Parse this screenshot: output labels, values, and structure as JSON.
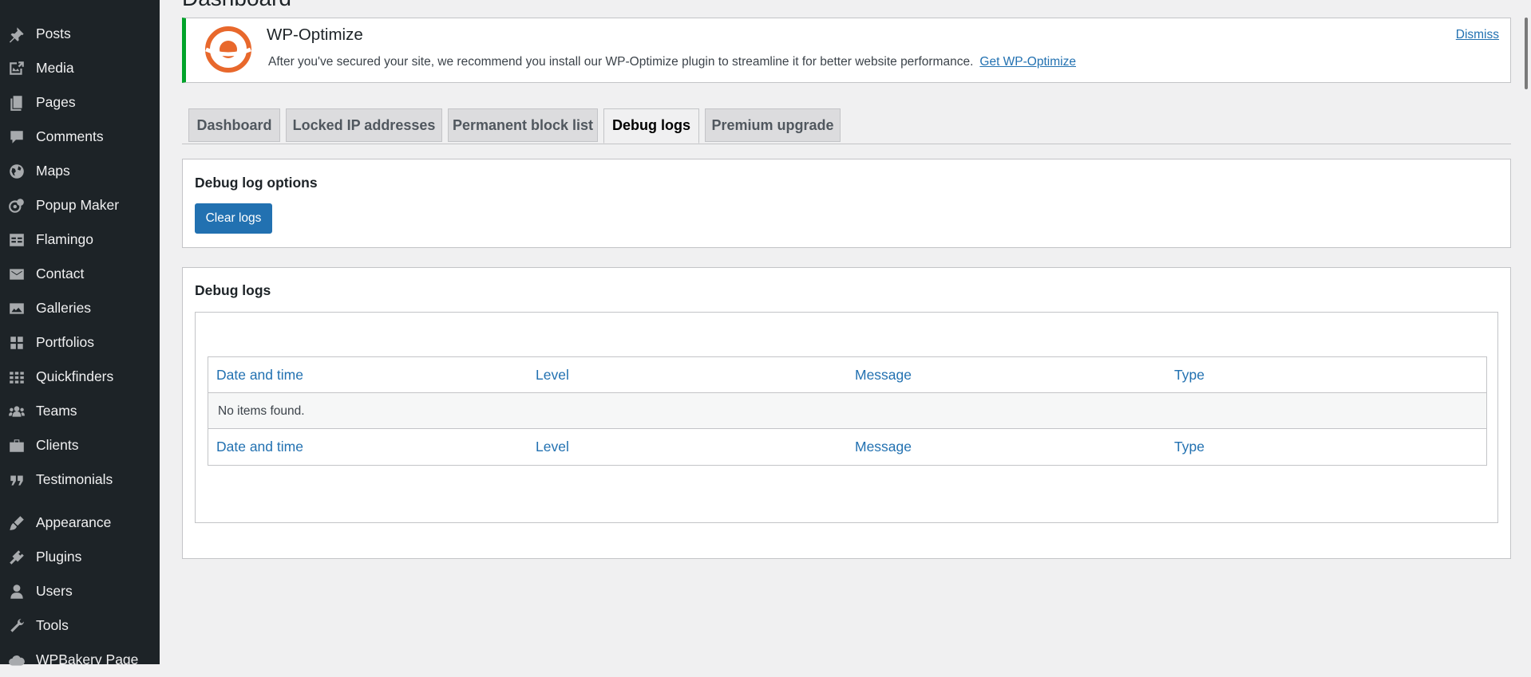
{
  "sidebar": {
    "items": [
      {
        "label": "Posts",
        "icon": "pin-icon"
      },
      {
        "label": "Media",
        "icon": "media-icon"
      },
      {
        "label": "Pages",
        "icon": "pages-icon"
      },
      {
        "label": "Comments",
        "icon": "comment-icon"
      },
      {
        "label": "Maps",
        "icon": "globe-icon"
      },
      {
        "label": "Popup Maker",
        "icon": "popup-icon"
      },
      {
        "label": "Flamingo",
        "icon": "feedback-icon"
      },
      {
        "label": "Contact",
        "icon": "email-icon"
      },
      {
        "label": "Galleries",
        "icon": "image-icon"
      },
      {
        "label": "Portfolios",
        "icon": "grid-icon"
      },
      {
        "label": "Quickfinders",
        "icon": "list-grid-icon"
      },
      {
        "label": "Teams",
        "icon": "groups-icon"
      },
      {
        "label": "Clients",
        "icon": "briefcase-icon"
      },
      {
        "label": "Testimonials",
        "icon": "quote-icon"
      },
      {
        "label": "Appearance",
        "icon": "brush-icon"
      },
      {
        "label": "Plugins",
        "icon": "plug-icon"
      },
      {
        "label": "Users",
        "icon": "user-icon"
      },
      {
        "label": "Tools",
        "icon": "wrench-icon"
      },
      {
        "label": "WPBakery Page",
        "icon": "cloud-icon"
      }
    ]
  },
  "page": {
    "title": "Dashboard"
  },
  "notice": {
    "title": "WP-Optimize",
    "text": "After you've secured your site, we recommend you install our WP-Optimize plugin to streamline it for better website performance.",
    "link": "Get WP-Optimize",
    "dismiss": "Dismiss",
    "accent": "#00a32a",
    "logo_color": "#e8682c"
  },
  "tabs": [
    {
      "label": "Dashboard",
      "active": false
    },
    {
      "label": "Locked IP addresses",
      "active": false
    },
    {
      "label": "Permanent block list",
      "active": false
    },
    {
      "label": "Debug logs",
      "active": true
    },
    {
      "label": "Premium upgrade",
      "active": false
    }
  ],
  "options_panel": {
    "title": "Debug log options",
    "button": "Clear logs"
  },
  "logs_panel": {
    "title": "Debug logs",
    "columns": [
      "Date and time",
      "Level",
      "Message",
      "Type"
    ],
    "empty": "No items found."
  },
  "colors": {
    "sidebar_bg": "#1d2327",
    "link": "#2271b1",
    "primary_button": "#2271b1"
  }
}
